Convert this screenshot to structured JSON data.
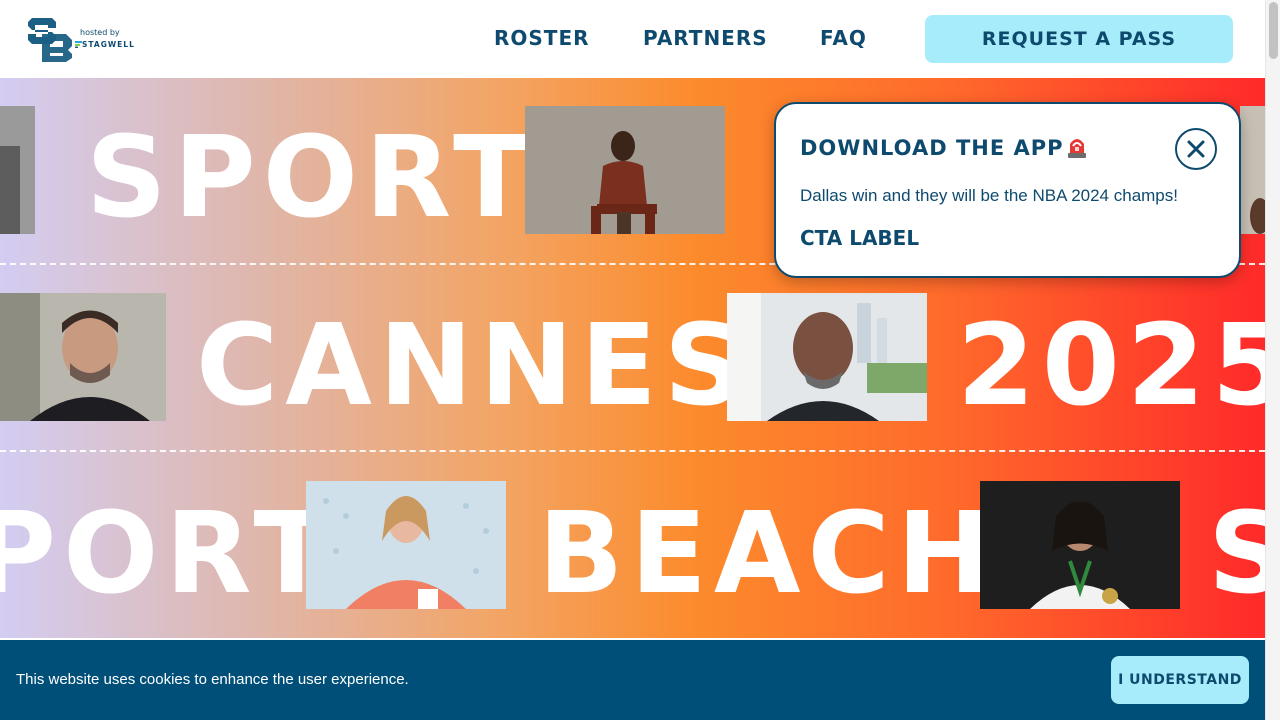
{
  "header": {
    "logo_alt": "SB",
    "hosted_by": "hosted by",
    "host_name": "STAGWELL",
    "nav": [
      {
        "label": "ROSTER"
      },
      {
        "label": "PARTNERS"
      },
      {
        "label": "FAQ"
      }
    ],
    "cta_label": "REQUEST A PASS"
  },
  "hero": {
    "row1": [
      "SPORT"
    ],
    "row2": [
      "CANNES",
      "2025"
    ],
    "row3": [
      "PORT",
      "BEACH",
      "S"
    ]
  },
  "popup": {
    "title": "DOWNLOAD THE APP",
    "icon": "siren-icon",
    "message": "Dallas win and they will be the NBA 2024 champs!",
    "cta_label": "CTA LABEL"
  },
  "cookie_bar": {
    "message": "This website uses cookies to enhance the user experience.",
    "button_label": "I UNDERSTAND"
  },
  "colors": {
    "brand_navy": "#0e4a6e",
    "cta_cyan": "#a6ecfb",
    "cookie_bg": "#004f78"
  }
}
